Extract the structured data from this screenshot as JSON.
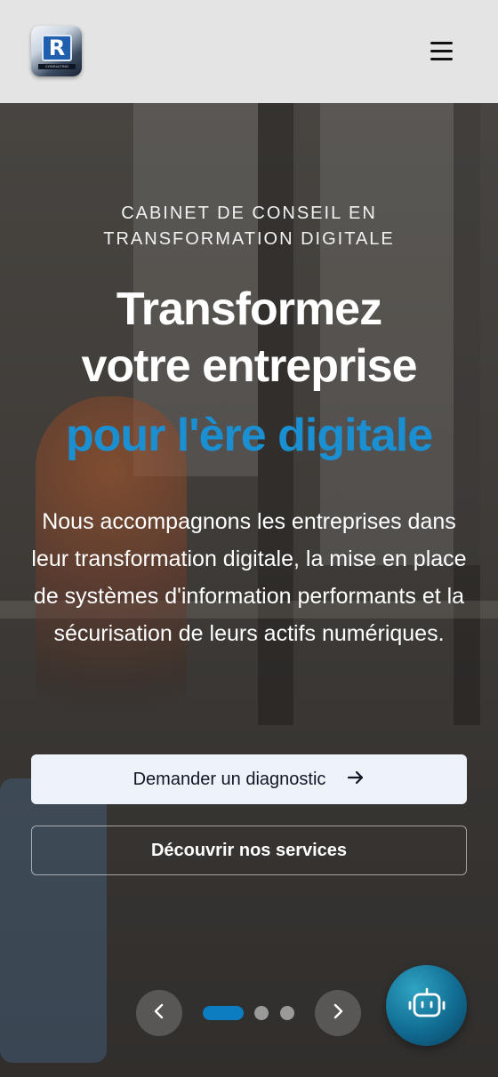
{
  "header": {
    "logo": {
      "letter": "R",
      "caption": "CONSULTING"
    },
    "menu_icon": "hamburger-menu-icon"
  },
  "hero": {
    "eyebrow": "CABINET DE CONSEIL EN\nTRANSFORMATION DIGITALE",
    "title_line1": "Transformez",
    "title_line2": "votre entreprise",
    "title_highlight": "pour l'ère digitale",
    "description": "Nous accompagnons les entreprises dans leur transformation digitale, la mise en place de systèmes d'information performants et la sécurisation de leurs actifs numériques.",
    "primary_button": "Demander un diagnostic",
    "secondary_button": "Découvrir nos services"
  },
  "carousel": {
    "slides": 3,
    "active_slide": 1,
    "prev_icon": "chevron-left-icon",
    "next_icon": "chevron-right-icon"
  },
  "chatbot": {
    "icon": "robot-icon"
  },
  "colors": {
    "accent": "#1a8fd1",
    "header_bg": "#e4e4e4",
    "primary_button_bg": "#eef3f9",
    "active_dot": "#0b7dc0"
  }
}
